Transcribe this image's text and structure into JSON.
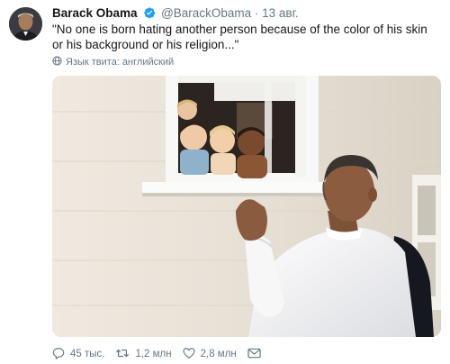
{
  "tweet": {
    "author_name": "Barack Obama",
    "handle": "@BarackObama",
    "separator": "·",
    "date": "13 авг.",
    "text": "\"No one is born hating another person because of the color of his skin or his background or his religion...\"",
    "language_label": "Язык твита: английский"
  },
  "actions": {
    "replies": "45 тыс.",
    "retweets": "1,2 млн",
    "likes": "2,8 млн"
  },
  "icons": {
    "verified": "verified-badge-icon",
    "globe": "globe-icon",
    "reply": "reply-icon",
    "retweet": "retweet-icon",
    "like": "heart-icon",
    "message": "envelope-icon"
  },
  "colors": {
    "verified_blue": "#1da1f2",
    "secondary_text": "#657786",
    "primary_text": "#14171a"
  }
}
